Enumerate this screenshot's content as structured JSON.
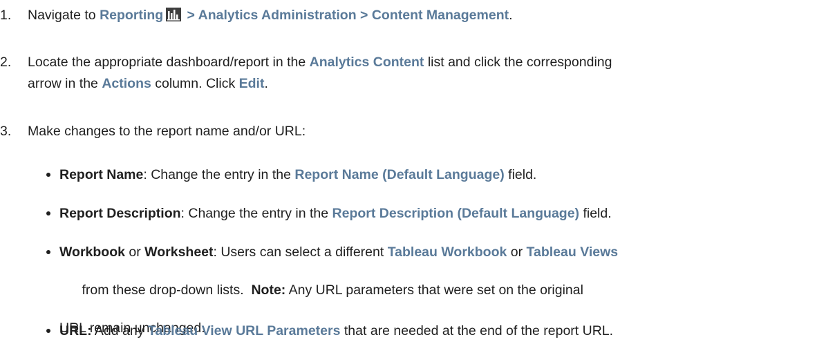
{
  "steps": [
    {
      "number": "1.",
      "text_intro": "Navigate to ",
      "path_reporting": "Reporting",
      "path_rest": " > Analytics Administration > Content Management",
      "text_end": "."
    },
    {
      "number": "2.",
      "line1_a": "Locate the appropriate dashboard/report in the ",
      "analytics_content": "Analytics Content",
      "line1_b": " list and click the corresponding",
      "line2_a": "arrow in the ",
      "actions": "Actions",
      "line2_b": " column. Click ",
      "edit": "Edit",
      "line2_c": "."
    },
    {
      "number": "3.",
      "text": "Make changes to the report name and/or URL:"
    }
  ],
  "bullets": {
    "report_name": {
      "label": "Report Name",
      "sep": ": Change the entry in the ",
      "field": "Report Name (Default Language)",
      "end": " field."
    },
    "report_description": {
      "label": "Report Description",
      "sep": ": Change the entry in the ",
      "field": "Report Description (Default Language)",
      "end": " field."
    },
    "workbook": {
      "label_a": "Workbook",
      "or": " or ",
      "label_b": "Worksheet",
      "text_a": ": Users can select a different ",
      "tableau_workbook": "Tableau Workbook",
      "or2": " or ",
      "tableau_views": "Tableau Views",
      "line2_a": "from these drop-down lists.  ",
      "note_label": "Note:",
      "line2_b": " Any URL parameters that were set on the original",
      "line3": "URL remain unchanged."
    },
    "url": {
      "label": "URL:",
      "text_a": " Add any ",
      "params": "Tableau View URL Parameters",
      "text_b": " that are needed at the end of the report URL."
    }
  },
  "colors": {
    "ui_link": "#5a7a99",
    "text": "#1f1f1f"
  },
  "icons": {
    "reporting": "bar-chart-icon"
  }
}
